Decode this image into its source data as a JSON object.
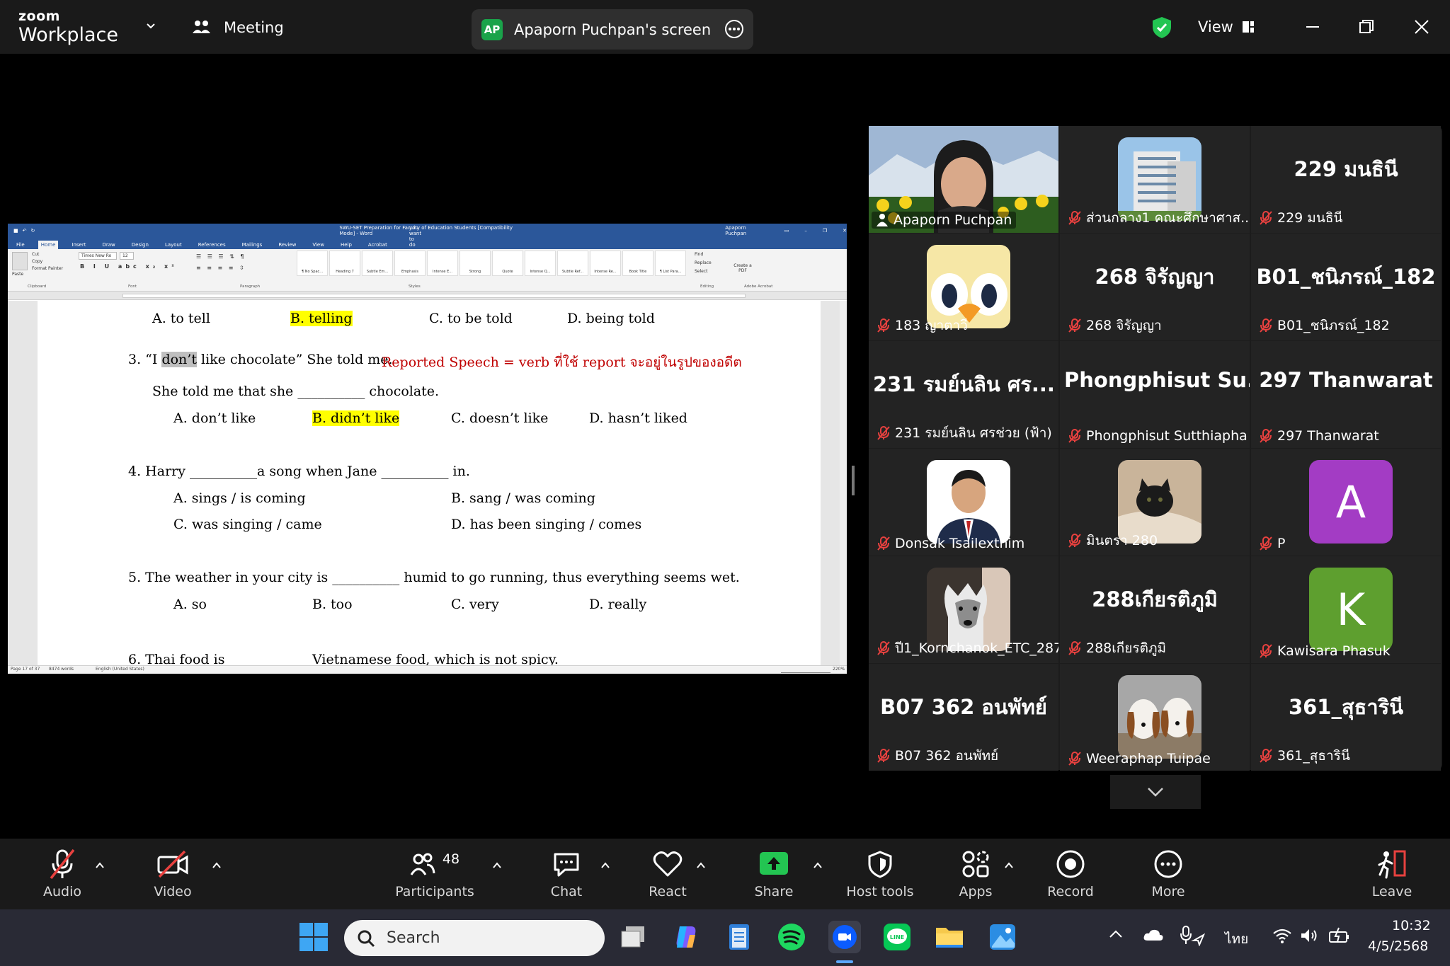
{
  "app": {
    "logo_line1": "zoom",
    "logo_line2": "Workplace",
    "meeting_label": "Meeting",
    "share_pill": {
      "initials": "AP",
      "text": "Apaporn Puchpan's screen"
    },
    "view_label": "View"
  },
  "word": {
    "title": "SWU-SET Preparation for Faculty of Education Students [Compatibility Mode] - Word",
    "user": "Apaporn Puchpan",
    "tabs": [
      "File",
      "Home",
      "Insert",
      "Draw",
      "Design",
      "Layout",
      "References",
      "Mailings",
      "Review",
      "View",
      "Help",
      "Acrobat"
    ],
    "active_tab": "Home",
    "tell_me": "Tell me what you want to do",
    "share": "Share",
    "font_name": "Times New Ro",
    "font_size": "12",
    "styles": [
      "¶ No Spac...",
      "Heading 7",
      "Subtle Em...",
      "Emphasis",
      "Intense E...",
      "Strong",
      "Quote",
      "Intense Q...",
      "Subtle Ref...",
      "Intense Re...",
      "Book Title",
      "¶ List Para..."
    ],
    "group_labels": [
      "Clipboard",
      "Font",
      "Paragraph",
      "Styles",
      "Editing",
      "Adobe Acrobat"
    ],
    "clipboard": [
      "Paste",
      "Cut",
      "Copy",
      "Format Painter"
    ],
    "editing": [
      "Find",
      "Replace",
      "Select"
    ],
    "acrobat": "Create a PDF",
    "status": {
      "page": "Page 17 of 37",
      "words": "8474 words",
      "lang": "English (United States)",
      "zoom": "220%"
    },
    "doc": {
      "q2_options": [
        "A. to tell",
        "B. telling",
        "C. to be told",
        "D. being told"
      ],
      "q3_pre": "3. “I ",
      "q3_sel": "don’t",
      "q3_post": " like chocolate” She told me.",
      "q3_note": "Reported Speech  =  verb ที่ใช้ report จะอยู่ในรูปของอดีต",
      "q3_line2a": "She told me that she __________ chocolate.",
      "q3_options": [
        "A. don’t like",
        "B. didn’t like",
        "C. doesn’t like",
        "D. hasn’t liked"
      ],
      "q4_line": "4. Harry __________a song when Jane __________ in.",
      "q4_options": [
        "A. sings / is coming",
        "B. sang / was coming",
        "C. was singing / came",
        "D. has been singing / comes"
      ],
      "q5_line": "5. The weather in your city is __________ humid to go running, thus everything seems wet.",
      "q5_options": [
        "A. so",
        "B. too",
        "C. very",
        "D. really"
      ],
      "q6_a": "6. Thai food is",
      "q6_b": "Vietnamese food, which is not spicy."
    }
  },
  "participants": [
    {
      "name": "Apaporn Puchpan",
      "kind": "photo",
      "icon": "teacher-photo",
      "muted": false,
      "active": true
    },
    {
      "name": "ส่วนกลาง1 คณะศึกษาศาส...",
      "kind": "photo",
      "icon": "building-photo",
      "muted": true
    },
    {
      "name": "229 มนธินี",
      "kind": "text",
      "display": "229 มนธินี",
      "muted": true
    },
    {
      "name": "183 ญาตาวี",
      "kind": "photo",
      "icon": "cartoon-bird-photo",
      "muted": true
    },
    {
      "name": "268 จิรัญญา",
      "kind": "text",
      "display": "268 จิรัญญา",
      "muted": true
    },
    {
      "name": "B01_ชนิภรณ์_182",
      "kind": "text",
      "display": "B01_ชนิภรณ์_182",
      "muted": true
    },
    {
      "name": "231 รมย์นลิน ศรช่วย (ฟ้า)",
      "kind": "text",
      "display": "231 รมย์นลิน ศร...",
      "muted": true
    },
    {
      "name": "Phongphisut Sutthiapha",
      "kind": "text",
      "display": "Phongphisut Su...",
      "muted": true
    },
    {
      "name": "297 Thanwarat",
      "kind": "text",
      "display": "297 Thanwarat",
      "muted": true
    },
    {
      "name": "Donsak Tsailexthim",
      "kind": "photo",
      "icon": "portrait-photo",
      "muted": true
    },
    {
      "name": "มินตรา 280",
      "kind": "photo",
      "icon": "kitten-photo",
      "muted": true
    },
    {
      "name": "P",
      "kind": "letter",
      "letter": "A",
      "color": "#a33cc4",
      "muted": true
    },
    {
      "name": "ปี1_Kornchanok_ETC_287",
      "kind": "photo",
      "icon": "wolf-photo",
      "muted": true
    },
    {
      "name": "288เกียรติภูมิ",
      "kind": "text",
      "display": "288เกียรติภูมิ",
      "muted": true
    },
    {
      "name": "Kawisara Phasuk",
      "kind": "letter",
      "letter": "K",
      "color": "#5e9f2f",
      "muted": true
    },
    {
      "name": "B07 362 อนพัทย์",
      "kind": "text",
      "display": "B07 362 อนพัทย์",
      "muted": true
    },
    {
      "name": "Weeraphap Tuipae",
      "kind": "photo",
      "icon": "dogs-photo",
      "muted": true
    },
    {
      "name": "361_สุธารินี",
      "kind": "text",
      "display": "361_สุธารินี",
      "muted": true
    }
  ],
  "toolbar": {
    "audio": "Audio",
    "video": "Video",
    "participants": "Participants",
    "participants_count": "48",
    "chat": "Chat",
    "react": "React",
    "share": "Share",
    "host_tools": "Host tools",
    "apps": "Apps",
    "record": "Record",
    "more": "More",
    "leave": "Leave"
  },
  "taskbar": {
    "search_placeholder": "Search",
    "lang": "ไทย",
    "time": "10:32",
    "date": "4/5/2568",
    "apps": [
      "windows-start-icon",
      "task-view-icon",
      "copilot-icon",
      "notepad-icon",
      "spotify-icon",
      "zoom-icon",
      "line-icon",
      "file-explorer-icon",
      "photos-icon"
    ]
  },
  "colors": {
    "accent_green": "#23d96b",
    "word_blue": "#2b579a",
    "share_green": "#23c552",
    "muted_red": "#e8413f"
  }
}
